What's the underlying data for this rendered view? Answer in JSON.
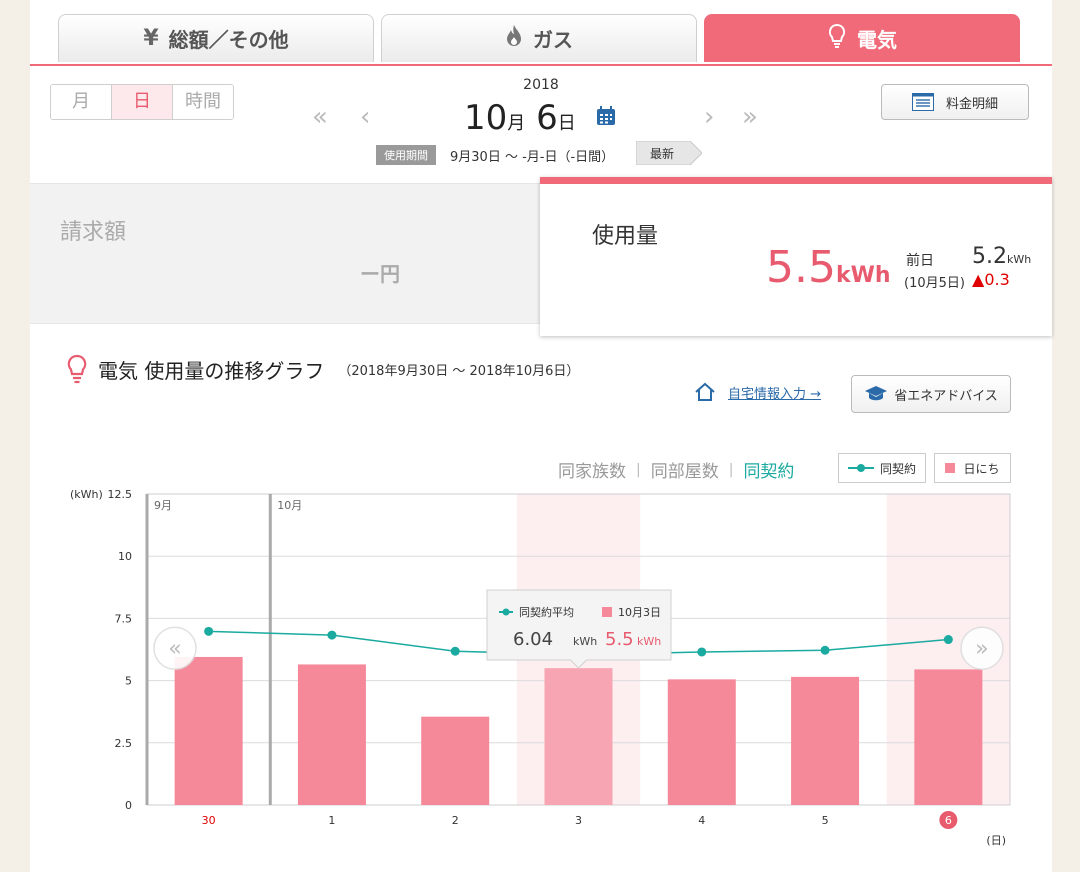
{
  "tabs": [
    {
      "icon": "yen-icon",
      "label": "総額／その他",
      "active": false
    },
    {
      "icon": "flame-icon",
      "label": "ガス",
      "active": false
    },
    {
      "icon": "bulb-icon",
      "label": "電気",
      "active": true
    }
  ],
  "period_selector": {
    "options": [
      "月",
      "日",
      "時間"
    ],
    "selected": "日"
  },
  "date": {
    "year": "2018",
    "month": "10",
    "month_unit": "月",
    "day": "6",
    "day_unit": "日"
  },
  "period": {
    "tag": "使用期間",
    "text": "9月30日 〜 -月-日（-日間）",
    "latest_label": "最新"
  },
  "detail_button": "料金明細",
  "billing": {
    "label": "請求額",
    "value": "ー円"
  },
  "usage": {
    "label": "使用量",
    "value": "5.5",
    "unit": "kWh",
    "prev_label": "前日",
    "prev_date": "(10月5日)",
    "prev_value": "5.2",
    "prev_unit": "kWh",
    "diff": "0.3"
  },
  "graph": {
    "title": "電気 使用量の推移グラフ",
    "range": "（2018年9月30日 〜 2018年10月6日）",
    "home_link": "自宅情報入力 →",
    "advice_button": "省エネアドバイス",
    "filters": [
      "同家族数",
      "同部屋数",
      "同契約"
    ],
    "active_filter": "同契約",
    "legend_line": "同契約",
    "legend_bar": "日にち",
    "tooltip": {
      "line_label": "同契約平均",
      "bar_label": "10月3日",
      "line_value": "6.04",
      "bar_value": "5.5",
      "unit": "kWh"
    }
  },
  "colors": {
    "accent": "#f06a7a",
    "bar": "#f5899a",
    "bar_selected": "#f7a5b2",
    "line": "#1aaaa0",
    "highlight": "#fdeef0"
  },
  "chart_data": {
    "type": "bar",
    "categories": [
      "30",
      "1",
      "2",
      "3",
      "4",
      "5",
      "6"
    ],
    "series": [
      {
        "name": "日にち",
        "type": "bar",
        "values": [
          5.95,
          5.65,
          3.55,
          5.5,
          5.05,
          5.15,
          5.45
        ]
      },
      {
        "name": "同契約",
        "type": "line",
        "values": [
          6.98,
          6.83,
          6.18,
          6.04,
          6.15,
          6.22,
          6.65
        ]
      }
    ],
    "ylabel": "(kWh)",
    "xlabel": "(日)",
    "ylim": [
      0,
      12.5
    ],
    "yticks": [
      "0",
      "2.5",
      "5",
      "7.5",
      "10",
      "12.5"
    ],
    "month_labels": [
      {
        "label": "9月",
        "index": 0
      },
      {
        "label": "10月",
        "index": 1
      }
    ],
    "highlighted": [
      "3",
      "6"
    ],
    "red_labels": [
      "30"
    ],
    "circled_label": "6",
    "grid": true
  }
}
